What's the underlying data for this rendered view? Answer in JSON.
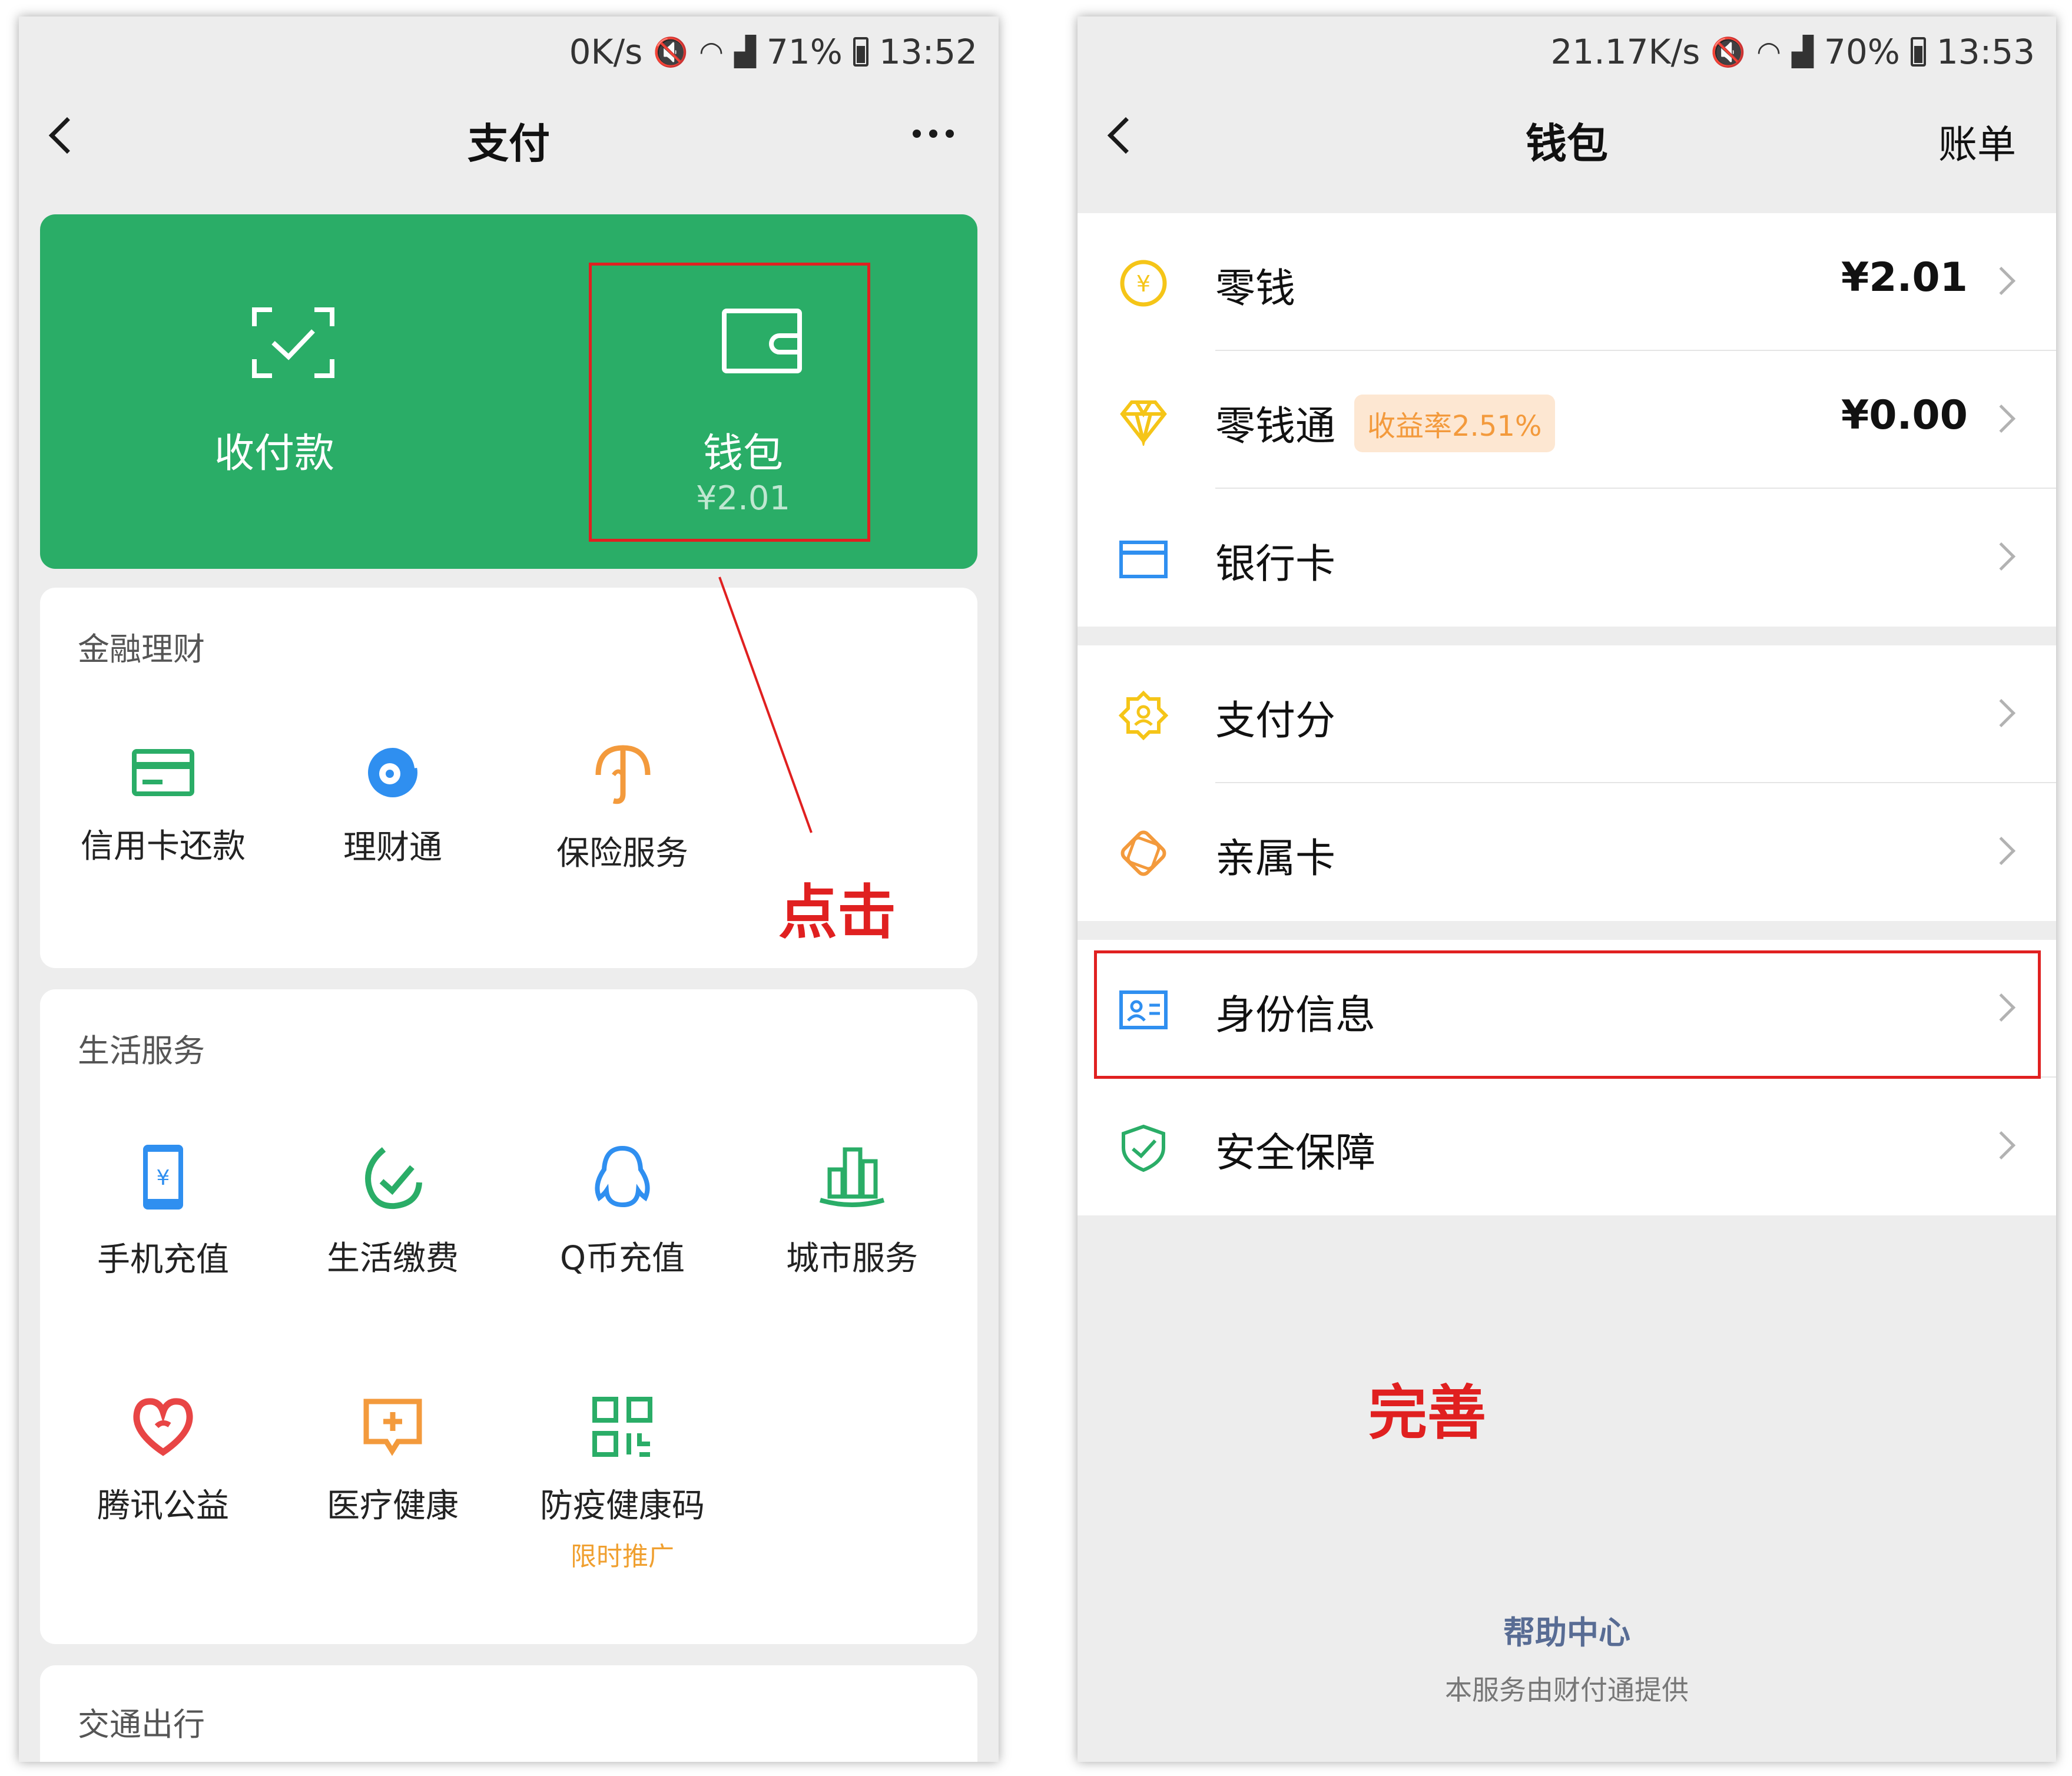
{
  "left": {
    "status": {
      "speed": "0K/s",
      "battery": "71%",
      "time": "13:52"
    },
    "nav": {
      "title": "支付"
    },
    "card": {
      "pay_label": "收付款",
      "wallet_label": "钱包",
      "wallet_amount": "¥2.01"
    },
    "finance": {
      "title": "金融理财",
      "items": [
        "信用卡还款",
        "理财通",
        "保险服务"
      ]
    },
    "life": {
      "title": "生活服务",
      "items": [
        "手机充值",
        "生活缴费",
        "Q币充值",
        "城市服务",
        "腾讯公益",
        "医疗健康",
        "防疫健康码"
      ],
      "promo": "限时推广"
    },
    "transport": {
      "title": "交通出行"
    },
    "annotation": "点击"
  },
  "right": {
    "status": {
      "speed": "21.17K/s",
      "battery": "70%",
      "time": "13:53"
    },
    "nav": {
      "title": "钱包",
      "action": "账单"
    },
    "rows": [
      {
        "label": "零钱",
        "value": "¥2.01"
      },
      {
        "label": "零钱通",
        "badge": "收益率2.51%",
        "value": "¥0.00"
      },
      {
        "label": "银行卡"
      },
      {
        "label": "支付分"
      },
      {
        "label": "亲属卡"
      },
      {
        "label": "身份信息"
      },
      {
        "label": "安全保障"
      }
    ],
    "help": "帮助中心",
    "provider": "本服务由财付通提供",
    "annotation": "完善"
  },
  "colors": {
    "green": "#2aad67",
    "annotation_red": "#e02020",
    "orange": "#f0a030",
    "link_blue": "#586c94"
  }
}
